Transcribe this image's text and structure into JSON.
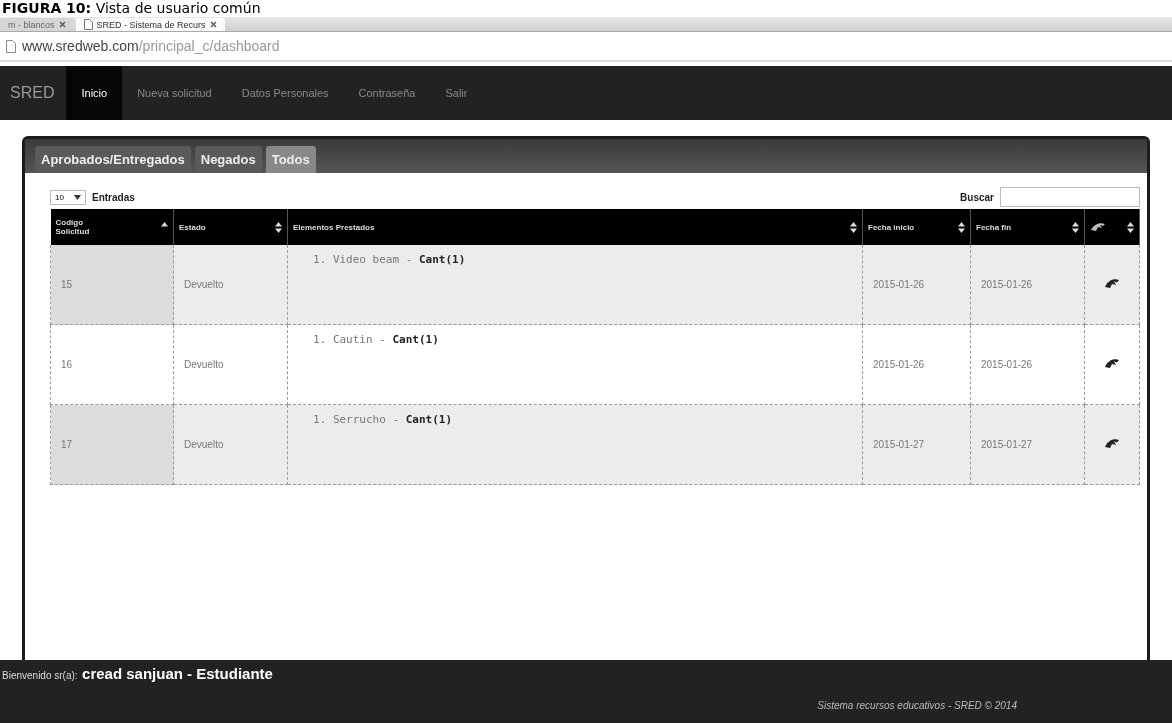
{
  "caption": "**FIGURA 10:** Vista de usuario común",
  "browser": {
    "tabs": [
      {
        "label": "m - blancos",
        "selected": false
      },
      {
        "label": "SRED - Sistema de Recurs",
        "selected": true
      }
    ],
    "url_host": "www.sredweb.com",
    "url_path": "/principal_c/dashboard"
  },
  "navbar": {
    "brand": "SRED",
    "items": [
      {
        "label": "Inicio",
        "selected": true
      },
      {
        "label": "Nueva solicitud",
        "selected": false
      },
      {
        "label": "Datos Personales",
        "selected": false
      },
      {
        "label": "Contraseña",
        "selected": false
      },
      {
        "label": "Salir",
        "selected": false
      }
    ]
  },
  "tabs": [
    {
      "label": "Aprobados/Entregados",
      "selected": false
    },
    {
      "label": "Negados",
      "selected": false
    },
    {
      "label": "Todos",
      "selected": true
    }
  ],
  "page_size": "10",
  "entries_label": "Entradas",
  "search_label": "Buscar",
  "table": {
    "columns": [
      {
        "label": "Codigo Solicitud",
        "sorted": true
      },
      {
        "label": "Estado",
        "sorted": false
      },
      {
        "label": "Elementos Prestados",
        "sorted": false
      },
      {
        "label": "Fecha inicio",
        "sorted": false
      },
      {
        "label": "Fecha fin",
        "sorted": false
      },
      {
        "kind": "icon",
        "sorted": false
      }
    ],
    "rows": [
      {
        "code": "15",
        "estado": "Devuelto",
        "items": [
          {
            "number": "1.",
            "text": "Video beam - **Cant(1)**"
          }
        ],
        "start": "2015-01-26",
        "end": "2015-01-26"
      },
      {
        "code": "16",
        "estado": "Devuelto",
        "items": [
          {
            "number": "1.",
            "text": "Cautin - **Cant(1)**"
          }
        ],
        "start": "2015-01-26",
        "end": "2015-01-26"
      },
      {
        "code": "17",
        "estado": "Devuelto",
        "items": [
          {
            "number": "1.",
            "text": "Serrucho - **Cant(1)**"
          }
        ],
        "start": "2015-01-27",
        "end": "2015-01-27"
      }
    ]
  },
  "footer": {
    "welcome": "Bienvenido sr(a):",
    "user": "cread sanjuan - Estudiante",
    "copyright": "Sistema recursos educativos - SRED © 2014"
  }
}
